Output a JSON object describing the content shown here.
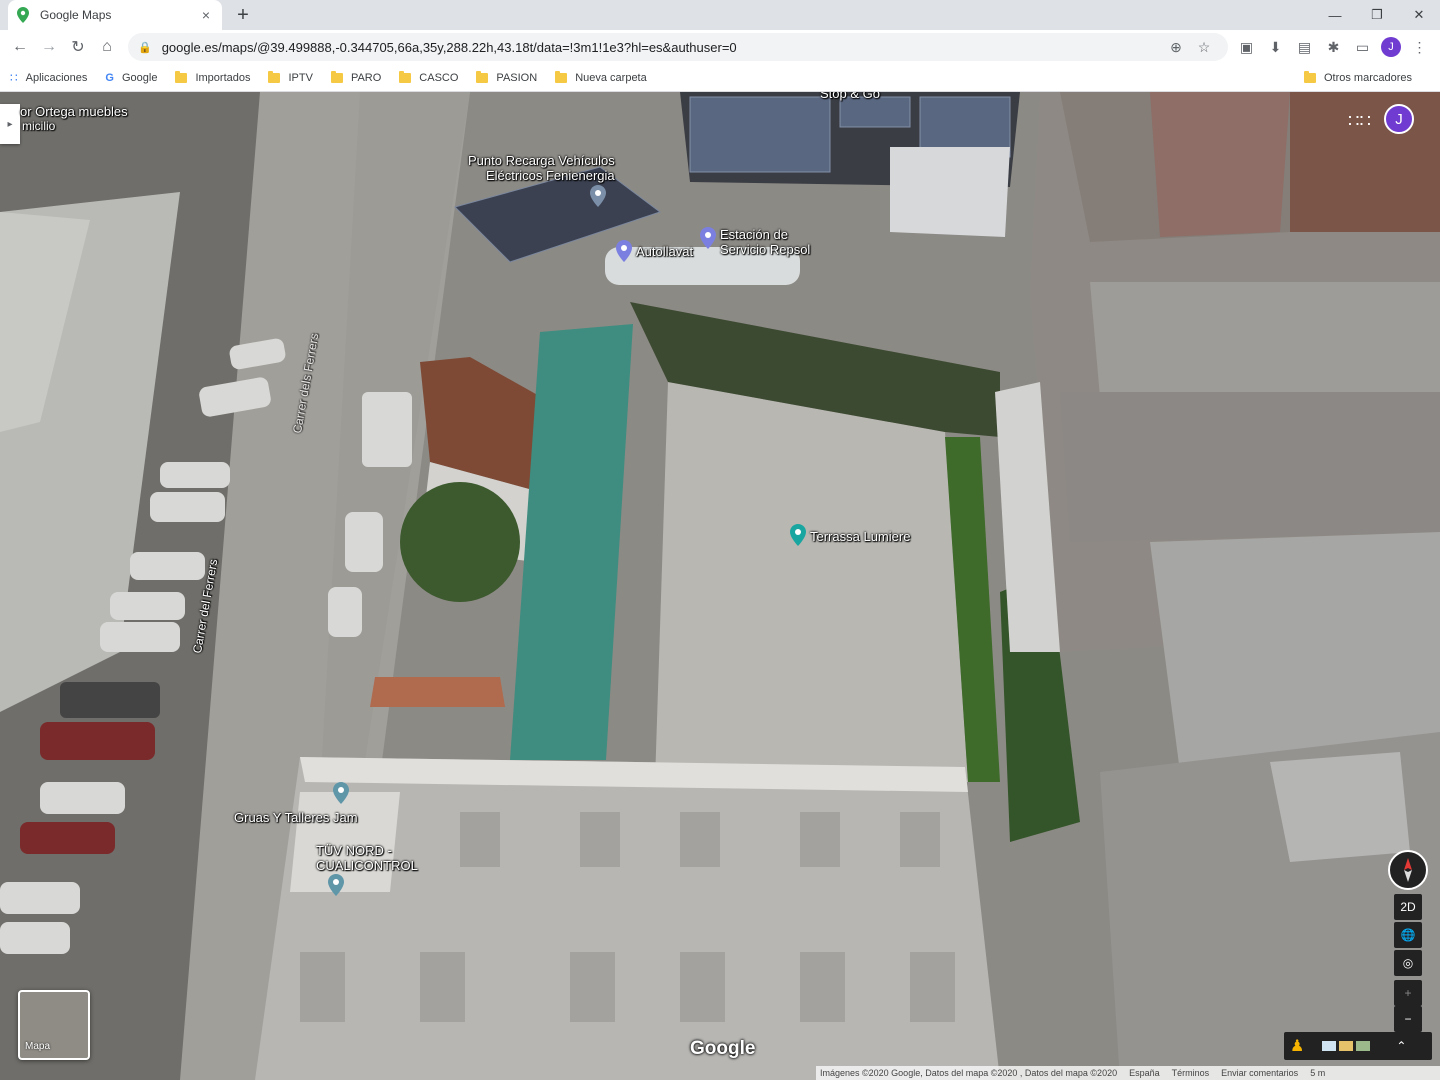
{
  "browser": {
    "tab_title": "Google Maps",
    "tab_close": "×",
    "new_tab": "+",
    "window_controls": [
      "—",
      "❐",
      "✕"
    ],
    "url": "google.es/maps/@39.499888,-0.344705,66a,35y,288.22h,43.18t/data=!3m1!1e3?hl=es&authuser=0",
    "profile_initial": "J"
  },
  "bookmarks": {
    "items": [
      {
        "label": "Aplicaciones",
        "icon": "apps-grid-icon"
      },
      {
        "label": "Google",
        "icon": "google-g-icon"
      },
      {
        "label": "Importados",
        "icon": "folder-icon"
      },
      {
        "label": "IPTV",
        "icon": "folder-icon"
      },
      {
        "label": "PARO",
        "icon": "folder-icon"
      },
      {
        "label": "CASCO",
        "icon": "folder-icon"
      },
      {
        "label": "PASION",
        "icon": "folder-icon"
      },
      {
        "label": "Nueva carpeta",
        "icon": "folder-icon"
      }
    ],
    "other": "Otros marcadores"
  },
  "map": {
    "labels": {
      "ortega_1": "or Ortega muebles",
      "ortega_2": "micilio",
      "recarga_1": "Punto Recarga Vehículos",
      "recarga_2": "Eléctricos Fenienergia",
      "stopgo": "Stop & Go",
      "autollavat": "Autollavat",
      "repsol_1": "Estación de",
      "repsol_2": "Servicio Repsol",
      "terrassa": "Terrassa Lumiere",
      "gruas": "Gruas Y Talleres Jam",
      "tuv_1": "TÜV NORD -",
      "tuv_2": "CUALICONTROL",
      "street_1": "Carrer del Ferrers",
      "street_2": "Carrer dels Ferrers"
    },
    "minimap_label": "Mapa",
    "google_logo": "Google",
    "profile_initial": "J",
    "controls": {
      "mode": "2D",
      "zoom_in": "+",
      "zoom_out": "−"
    },
    "footer": {
      "attribution": "Imágenes ©2020 Google, Datos del mapa ©2020 , Datos del mapa ©2020",
      "country": "España",
      "terms": "Términos",
      "feedback": "Enviar comentarios",
      "scale": "5 m"
    }
  }
}
